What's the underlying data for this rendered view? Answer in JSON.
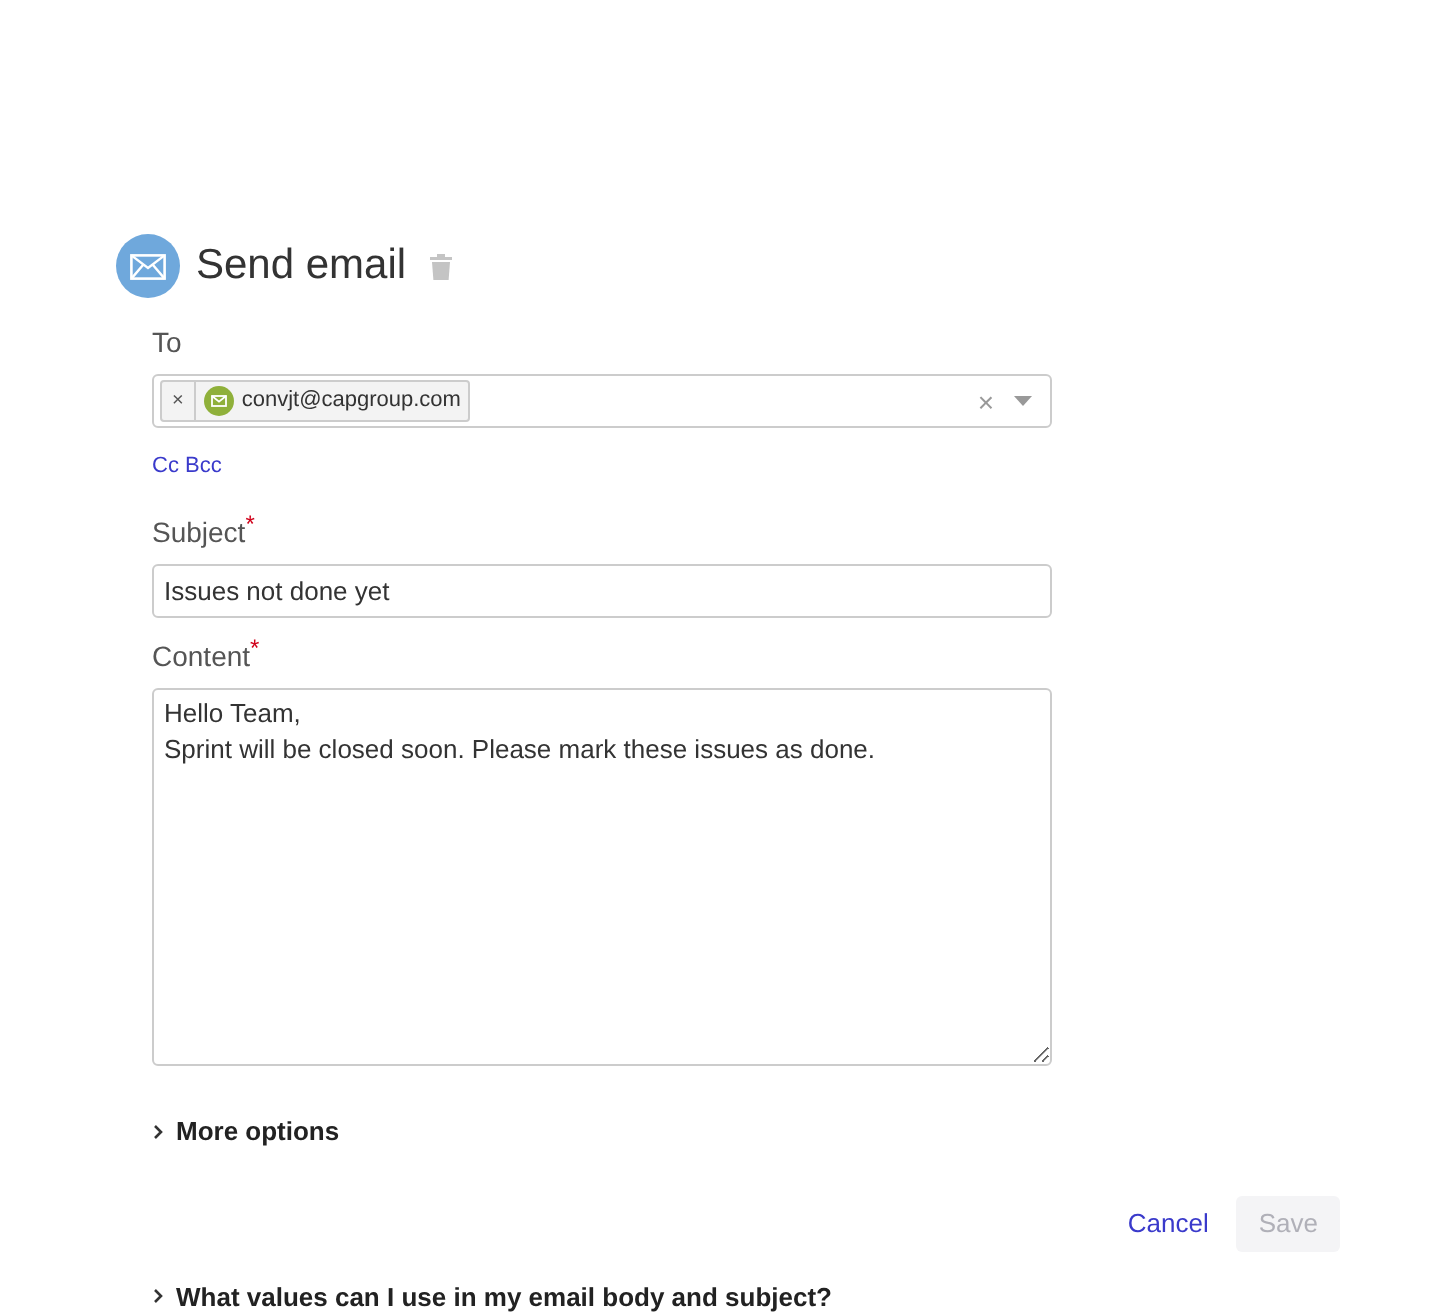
{
  "header": {
    "title": "Send email"
  },
  "to": {
    "label": "To",
    "chips": [
      {
        "remove": "×",
        "email": "convjt@capgroup.com"
      }
    ],
    "clear": "×",
    "cc_bcc": "Cc Bcc"
  },
  "subject": {
    "label": "Subject",
    "required_mark": "*",
    "value": "Issues not done yet"
  },
  "content": {
    "label": "Content",
    "required_mark": "*",
    "value": "Hello Team,\nSprint will be closed soon. Please mark these issues as done."
  },
  "sections": [
    {
      "label": "More options",
      "expanded": false
    }
  ],
  "actions": {
    "cancel": "Cancel",
    "save": {
      "label": "Save",
      "disabled": true
    }
  },
  "help": {
    "label": "What values can I use in my email body and subject?",
    "expanded": false
  }
}
